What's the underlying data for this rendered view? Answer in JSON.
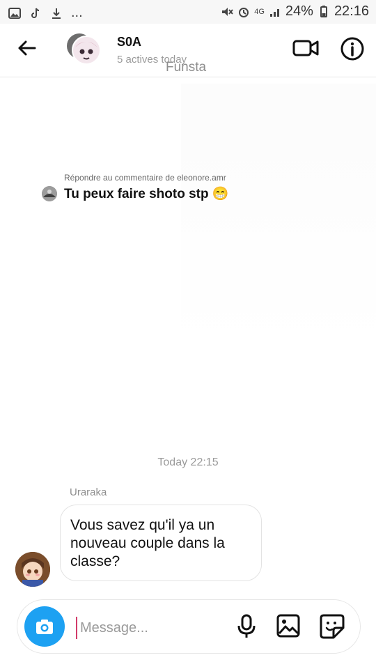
{
  "status_bar": {
    "left_icons": [
      "image-icon",
      "tiktok-icon",
      "download-icon"
    ],
    "more": "...",
    "battery": "24%",
    "time": "22:16",
    "network": "4G"
  },
  "header": {
    "title": "S0A",
    "subtitle": "5 actives today",
    "overlay": "Funsta"
  },
  "reply": {
    "label": "Répondre au commentaire de eleonore.amr",
    "text": "Tu peux faire shoto stp 😁"
  },
  "conversation": {
    "timestamp": "Today 22:15",
    "sender": "Uraraka",
    "message": "Vous savez qu'il ya un nouveau couple dans la classe?"
  },
  "composer": {
    "placeholder": "Message..."
  },
  "colors": {
    "camera_button": "#1da1f2",
    "cursor": "#d23c6a",
    "muted_text": "#9a9a9a"
  }
}
